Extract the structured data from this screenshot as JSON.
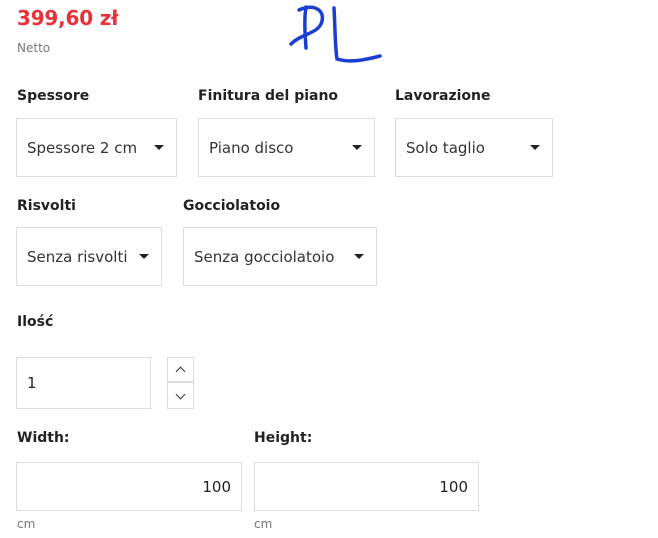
{
  "price": {
    "amount": "399,60 zł",
    "note": "Netto"
  },
  "annotation": {
    "handwritten": "PL"
  },
  "options": {
    "thickness": {
      "label": "Spessore",
      "value": "Spessore 2 cm"
    },
    "finish": {
      "label": "Finitura del piano",
      "value": "Piano disco"
    },
    "processing": {
      "label": "Lavorazione",
      "value": "Solo taglio"
    },
    "returns": {
      "label": "Risvolti",
      "value": "Senza risvolti"
    },
    "drip": {
      "label": "Gocciolatoio",
      "value": "Senza gocciolatoio"
    }
  },
  "quantity": {
    "label": "Ilość",
    "value": "1"
  },
  "dimensions": {
    "width": {
      "label": "Width:",
      "value": "100",
      "unit": "cm"
    },
    "height": {
      "label": "Height:",
      "value": "100",
      "unit": "cm"
    }
  },
  "icons": {
    "caret": "caret-down-icon",
    "stepper_up": "chevron-up-icon",
    "stepper_down": "chevron-down-icon"
  }
}
